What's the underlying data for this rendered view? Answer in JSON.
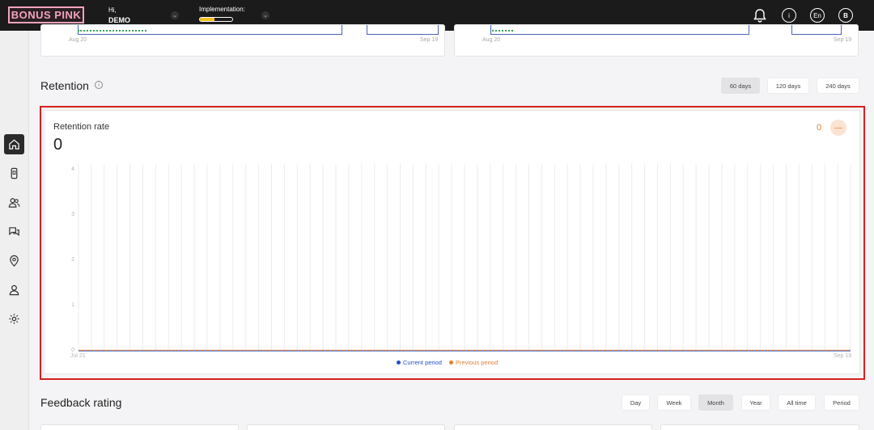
{
  "brand": "BONUS PINK",
  "header": {
    "greeting": "Hi,",
    "user": "DEMO",
    "implementation_label": "Implementation:",
    "implementation_progress": 0.45,
    "language": "En",
    "avatar_initial": "B"
  },
  "top_cards": [
    {
      "start": "Aug 20",
      "end": "Sep 19"
    },
    {
      "start": "Aug 20",
      "end": "Sep 19"
    }
  ],
  "retention": {
    "title": "Retention",
    "ranges": [
      "60 days",
      "120 days",
      "240 days"
    ],
    "selected_range": "60 days"
  },
  "chart_data": {
    "type": "line",
    "title": "Retention rate",
    "headline_value": "0",
    "change_value": "0",
    "x_start": "Jul 21",
    "x_end": "Sep 19",
    "yticks": [
      "4",
      "3",
      "2",
      "1",
      "0"
    ],
    "ylim": [
      0,
      4
    ],
    "grid": true,
    "legend_position": "bottom",
    "series": [
      {
        "name": "Current period",
        "color": "#2350c8",
        "values": [
          0,
          0
        ]
      },
      {
        "name": "Previous period",
        "color": "#e0813a",
        "values": [
          0,
          0
        ]
      }
    ]
  },
  "feedback": {
    "title": "Feedback rating",
    "ranges": [
      "Day",
      "Week",
      "Month",
      "Year",
      "All time",
      "Period"
    ],
    "selected_range": "Month"
  }
}
